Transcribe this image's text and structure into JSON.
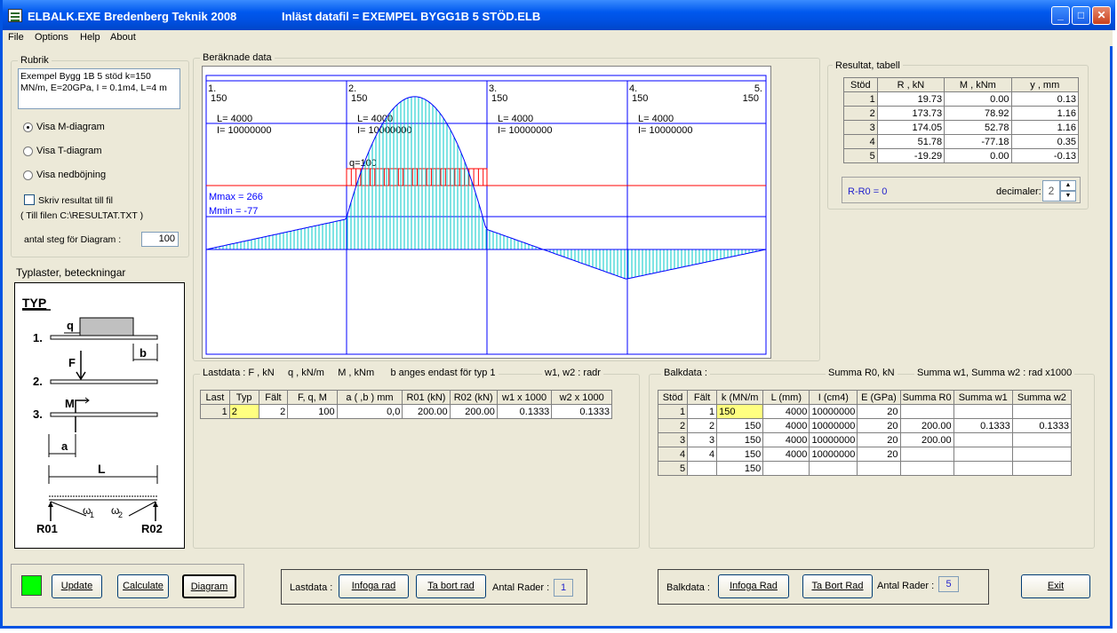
{
  "title": {
    "app": "ELBALK.EXE Bredenberg Teknik 2008",
    "file": "Inläst datafil = EXEMPEL BYGG1B 5 STÖD.ELB"
  },
  "menu": [
    "File",
    "Options",
    "Help",
    "About"
  ],
  "rubrik": {
    "legend": "Rubrik",
    "text": "Exempel Bygg 1B   5 stöd k=150 MN/m, E=20GPa, I = 0.1m4, L=4 m"
  },
  "options": {
    "radio_m": "Visa M-diagram",
    "radio_t": "Visa T-diagram",
    "radio_ned": "Visa nedböjning",
    "radio_selected": "m",
    "check_label": "Skriv resultat till fil",
    "file_note": "( Till filen C:\\RESULTAT.TXT )",
    "steps_label": "antal steg för Diagram :",
    "steps_value": "100"
  },
  "typ": {
    "heading": "Typlaster, beteckningar",
    "title": "TYP",
    "n1": "1.",
    "n2": "2.",
    "n3": "3.",
    "q": "q",
    "b": "b",
    "F": "F",
    "M": "M",
    "a": "a",
    "L": "L",
    "w1": "ω",
    "w1sub": "1",
    "w2": "ω",
    "w2sub": "2",
    "r1": "R01",
    "r2": "R02"
  },
  "diagram": {
    "legend": "Beräknade data",
    "supports": [
      {
        "no": "1.",
        "k": "150"
      },
      {
        "no": "2.",
        "k": "150"
      },
      {
        "no": "3.",
        "k": "150"
      },
      {
        "no": "4.",
        "k": "150"
      },
      {
        "no": "5.",
        "k": "150"
      }
    ],
    "spans": [
      {
        "L": "L= 4000",
        "I": "I= 10000000"
      },
      {
        "L": "L= 4000",
        "I": "I= 10000000"
      },
      {
        "L": "L= 4000",
        "I": "I= 10000000"
      },
      {
        "L": "L= 4000",
        "I": "I= 10000000"
      }
    ],
    "load_label": "q=100",
    "mmax": "Mmax = 266",
    "mmin": "Mmin = -77"
  },
  "chart_data": {
    "type": "area",
    "title": "",
    "xlabel": "",
    "ylabel": "",
    "x": [
      0,
      2000,
      4000,
      6000,
      8000,
      10000,
      12000,
      14000,
      16000
    ],
    "values": [
      0,
      -39,
      -79,
      -266,
      -53,
      13,
      77,
      39,
      0
    ],
    "ylim": [
      -266,
      77
    ]
  },
  "results": {
    "legend": "Resultat, tabell",
    "columns": [
      "Stöd",
      "R , kN",
      "M , kNm",
      "y , mm"
    ],
    "rows": [
      [
        "1",
        "19.73",
        "0.00",
        "0.13"
      ],
      [
        "2",
        "173.73",
        "78.92",
        "1.16"
      ],
      [
        "3",
        "174.05",
        "52.78",
        "1.16"
      ],
      [
        "4",
        "51.78",
        "-77.18",
        "0.35"
      ],
      [
        "5",
        "-19.29",
        "0.00",
        "-0.13"
      ]
    ],
    "rr0": "R-R0 = 0",
    "dec_label": "decimaler:",
    "dec_value": "2"
  },
  "lastdata": {
    "legend": "Lastdata : F , kN     q , kN/m     M , kNm      b anges endast för typ 1",
    "legend2": "w1, w2  : radr",
    "columns": [
      "Last",
      "Typ",
      "Fält",
      "F, q, M",
      "a ( ,b )  mm",
      "R01 (kN)",
      "R02 (kN)",
      "w1 x 1000",
      "w2 x 1000"
    ],
    "rows": [
      [
        "1",
        "2",
        "2",
        "100",
        "0,0",
        "200.00",
        "200.00",
        "0.1333",
        "0.1333"
      ]
    ]
  },
  "balkdata": {
    "legend": "Balkdata :",
    "legend2": "Summa R0, kN",
    "legend3": "Summa w1,  Summa w2 : rad x1000",
    "columns": [
      "Stöd",
      "Fält",
      "k (MN/m",
      "L (mm)",
      "I (cm4)",
      "E (GPa)",
      "Summa R0",
      "Summa w1",
      "Summa w2"
    ],
    "rows": [
      [
        "1",
        "1",
        "150",
        "4000",
        "10000000",
        "20",
        "",
        "",
        ""
      ],
      [
        "2",
        "2",
        "150",
        "4000",
        "10000000",
        "20",
        "200.00",
        "0.1333",
        "0.1333"
      ],
      [
        "3",
        "3",
        "150",
        "4000",
        "10000000",
        "20",
        "200.00",
        "",
        ""
      ],
      [
        "4",
        "4",
        "150",
        "4000",
        "10000000",
        "20",
        "",
        "",
        ""
      ],
      [
        "5",
        "",
        "150",
        "",
        "",
        "",
        "",
        "",
        ""
      ]
    ]
  },
  "bottom": {
    "update": "Update",
    "calculate": "Calculate",
    "diagram": "Diagram",
    "lastdata_label": "Lastdata :",
    "infoga_rad": "Infoga rad",
    "ta_bort_rad": "Ta bort rad",
    "antal_rader": "Antal Rader :",
    "antal_last": "1",
    "balkdata_label": "Balkdata :",
    "infoga_rad2": "Infoga Rad",
    "ta_bort_rad2": "Ta Bort Rad",
    "antal_rader2": "Antal Rader :",
    "antal_balk": "5",
    "exit": "Exit"
  },
  "colors": {
    "status_green": "#00ff00",
    "moment_fill": "#00c8c8",
    "moment_line": "#0000ff",
    "load": "#ff0000"
  }
}
